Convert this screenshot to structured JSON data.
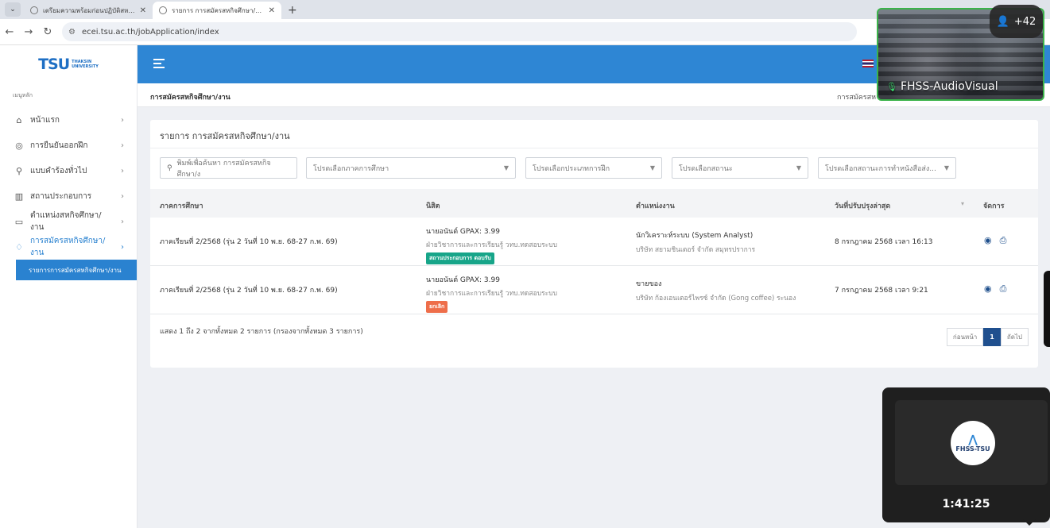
{
  "browser": {
    "tabs": [
      {
        "title": "เตรียมความพร้อมก่อนปฏิบัติสหกิจศึกษา",
        "active": false
      },
      {
        "title": "รายการ การสมัครสหกิจศึกษา/งาน",
        "active": true
      }
    ],
    "new_tab": "+",
    "url": "ecei.tsu.ac.th/jobApplication/index"
  },
  "sidebar": {
    "logo_text": "TSU",
    "logo_sub1": "THAKSIN",
    "logo_sub2": "UNIVERSITY",
    "menu_title": "เมนูหลัก",
    "items": [
      {
        "label": "หน้าแรก",
        "icon": "home-icon"
      },
      {
        "label": "การยืนยันออกฝึก",
        "icon": "check-circle-icon"
      },
      {
        "label": "แบบคำร้องทั่วไป",
        "icon": "sitemap-icon"
      },
      {
        "label": "สถานประกอบการ",
        "icon": "building-icon"
      },
      {
        "label": "ตำแหน่งสหกิจศึกษา/งาน",
        "icon": "briefcase-icon"
      },
      {
        "label": "การสมัครสหกิจศึกษา/งาน",
        "icon": "handshake-icon"
      }
    ],
    "sub_item": "รายการการสมัครสหกิจศึกษา/งาน"
  },
  "header": {
    "page_title": "การสมัครสหกิจศึกษา/งาน",
    "breadcrumb": "การสมัครสห"
  },
  "card": {
    "title": "รายการ การสมัครสหกิจศึกษา/งาน",
    "search_placeholder": "พิมพ์เพื่อค้นหา การสมัครสหกิจศึกษา/ง",
    "filters": [
      "โปรดเลือกภาคการศึกษา",
      "โปรดเลือกประเภทการฝึก",
      "โปรดเลือกสถานะ",
      "โปรดเลือกสถานะการทำหนังสือส่ง..."
    ],
    "columns": [
      "ภาคการศึกษา",
      "นิสิต",
      "ตำแหน่งงาน",
      "วันที่ปรับปรุงล่าสุด",
      "จัดการ"
    ],
    "rows": [
      {
        "term": "ภาคเรียนที่ 2/2568 (รุ่น 2 วันที่ 10 พ.ย. 68-27 ก.พ. 69)",
        "student": "นายอนันต์ GPAX: 3.99",
        "dept": "ฝ่ายวิชาการและการเรียนรู้ วทบ.ทดสอบระบบ",
        "status": "สถานประกอบการ ตอบรับ",
        "status_color": "#17a589",
        "position": "นักวิเคราะห์ระบบ (System Analyst)",
        "company": "บริษัท สยามชินเตอร์ จำกัด สมุทรปราการ",
        "updated": "8 กรกฎาคม 2568 เวลา 16:13"
      },
      {
        "term": "ภาคเรียนที่ 2/2568 (รุ่น 2 วันที่ 10 พ.ย. 68-27 ก.พ. 69)",
        "student": "นายอนันต์ GPAX: 3.99",
        "dept": "ฝ่ายวิชาการและการเรียนรู้ วทบ.ทดสอบระบบ",
        "status": "ยกเลิก",
        "status_color": "#ee6e4a",
        "position": "ขายของ",
        "company": "บริษัท ก้องเอนเตอร์ไพรซ์ จำกัด (Gong coffee) ระนอง",
        "updated": "7 กรกฎาคม 2568 เวลา 9:21"
      }
    ],
    "footer_info": "แสดง 1 ถึง 2 จากทั้งหมด 2 รายการ (กรองจากทั้งหมด 3 รายการ)",
    "pager": {
      "prev": "ก่อนหน้า",
      "current": "1",
      "next": "ถัดไป"
    }
  },
  "overlay": {
    "participants": "+42",
    "camera_name": "FHSS-AudioVisual",
    "self_logo": "FHSS-TSU",
    "timer": "1:41:25"
  }
}
